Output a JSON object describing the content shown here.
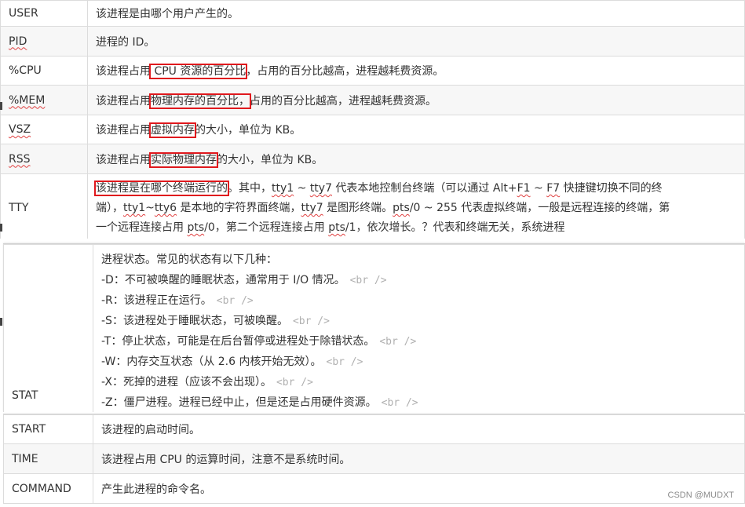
{
  "rows_top": [
    {
      "key": "USER",
      "desc": "该进程是由哪个用户产生的。"
    },
    {
      "key": "PID",
      "desc": "进程的 ID。"
    },
    {
      "key": "%CPU",
      "desc_a": "该进程占用",
      "desc_hl": " CPU 资源的百分比",
      "desc_b": "，占用的百分比越高，进程越耗费资源。"
    },
    {
      "key": "%MEM",
      "desc_a": "该进程占用",
      "desc_hl": "物理内存的百分比，",
      "desc_b": "占用的百分比越高，进程越耗费资源。"
    },
    {
      "key": "VSZ",
      "desc_a": "该进程占用",
      "desc_hl": "虚拟内存",
      "desc_b": "的大小，单位为 KB。"
    },
    {
      "key": "RSS",
      "desc_a": "该进程占用",
      "desc_hl": "实际物理内存",
      "desc_b": "的大小，单位为 KB。"
    }
  ],
  "tty": {
    "key": "TTY",
    "hl": "该进程是在哪个终端运行的",
    "line1_a": "。其中，",
    "tty1": "tty1",
    "line1_b": " ~ ",
    "tty7": "tty7",
    "line1_c": " 代表本地控制台终端（可以通过 Alt+",
    "f1": "F1",
    "line1_d": " ~ ",
    "f7": "F7",
    "line1_e": " 快捷键切换不同的终",
    "line2_a": "端），",
    "tty1b": "tty1",
    "line2_b": "~",
    "tty6": "tty6",
    "line2_c": " 是本地的字符界面终端，",
    "tty7b": "tty7",
    "line2_d": " 是图形终端。",
    "pts0": "pts",
    "line2_e": "/0 ~ 255 代表虚拟终端，一般是远程连接的终端，第",
    "line3_a": "一个远程连接占用 ",
    "pts0b": "pts",
    "line3_b": "/0，第二个远程连接占用 ",
    "pts1": "pts",
    "line3_c": "/1，依次增长。？代表和终端无关，系统进程"
  },
  "stat": {
    "key": "STAT",
    "lines": [
      {
        "text": "进程状态。常见的状态有以下几种：",
        "br": ""
      },
      {
        "text": "-D：不可被唤醒的睡眠状态，通常用于 I/O 情况。",
        "br": "<br />"
      },
      {
        "text": "-R：该进程正在运行。",
        "br": "<br />"
      },
      {
        "text": "-S：该进程处于睡眠状态，可被唤醒。",
        "br": "<br />"
      },
      {
        "text": "-T：停止状态，可能是在后台暂停或进程处于除错状态。",
        "br": "<br />"
      },
      {
        "text": "-W：内存交互状态（从 2.6 内核开始无效）。",
        "br": "<br />"
      },
      {
        "text": "-X：死掉的进程（应该不会出现）。",
        "br": "<br />"
      },
      {
        "text": "-Z：僵尸进程。进程已经中止，但是还是占用硬件资源。",
        "br": "<br />"
      }
    ]
  },
  "rows_bottom": [
    {
      "key": "START",
      "desc": "该进程的启动时间。"
    },
    {
      "key": "TIME",
      "desc": "该进程占用 CPU 的运算时间，注意不是系统时间。"
    },
    {
      "key": "COMMAND",
      "desc": "产生此进程的命令名。"
    }
  ],
  "watermark": "CSDN @MUDXT",
  "colors": {
    "highlight_box": "#e0181d",
    "spell_underline": "#e04040",
    "alt_row": "#f7f7f7"
  }
}
